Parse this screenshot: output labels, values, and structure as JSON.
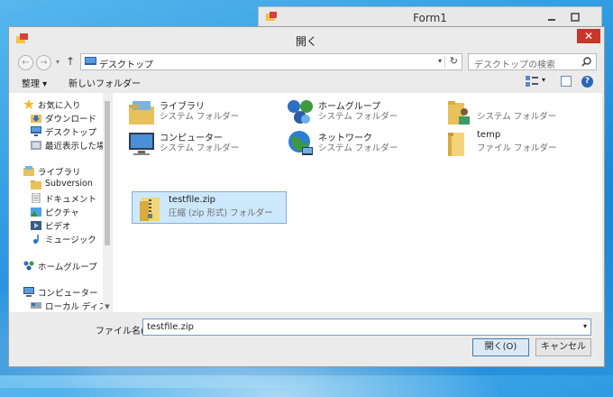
{
  "form1": {
    "title": "Form1"
  },
  "dialog": {
    "title": "開く",
    "close": "✕",
    "address": {
      "path": "デスクトップ",
      "dropdown": "▾",
      "refresh": "↻"
    },
    "nav": {
      "back": "←",
      "forward": "→",
      "history": "▾",
      "up": "↑"
    },
    "search": {
      "placeholder": "デスクトップの検索"
    },
    "toolbar": {
      "organize": "整理 ▾",
      "new_folder": "新しいフォルダー",
      "view_dropdown": "▾",
      "help": "?"
    },
    "sidebar": {
      "favorites": [
        {
          "label": "お気に入り",
          "icon": "star-icon"
        },
        {
          "label": "ダウンロード",
          "icon": "download-folder-icon"
        },
        {
          "label": "デスクトップ",
          "icon": "desktop-icon"
        },
        {
          "label": "最近表示した場所",
          "icon": "recent-places-icon"
        }
      ],
      "libraries": [
        {
          "label": "ライブラリ",
          "icon": "library-icon"
        },
        {
          "label": "Subversion",
          "icon": "folder-icon"
        },
        {
          "label": "ドキュメント",
          "icon": "documents-icon"
        },
        {
          "label": "ピクチャ",
          "icon": "pictures-icon"
        },
        {
          "label": "ビデオ",
          "icon": "videos-icon"
        },
        {
          "label": "ミュージック",
          "icon": "music-icon"
        }
      ],
      "homegroup": {
        "label": "ホームグループ",
        "icon": "homegroup-icon"
      },
      "computer": [
        {
          "label": "コンピューター",
          "icon": "computer-icon"
        },
        {
          "label": "ローカル ディスク (C",
          "icon": "drive-icon"
        }
      ]
    },
    "items": [
      {
        "name": "ライブラリ",
        "sub": "システム フォルダー",
        "icon": "library-icon"
      },
      {
        "name": "ホームグループ",
        "sub": "システム フォルダー",
        "icon": "homegroup-icon"
      },
      {
        "name": "",
        "sub": "システム フォルダー",
        "icon": "user-folder-icon"
      },
      {
        "name": "コンピューター",
        "sub": "システム フォルダー",
        "icon": "computer-icon"
      },
      {
        "name": "ネットワーク",
        "sub": "システム フォルダー",
        "icon": "network-icon"
      },
      {
        "name": "temp",
        "sub": "ファイル フォルダー",
        "icon": "folder-icon"
      },
      {
        "name": "testfile.zip",
        "sub": "圧縮 (zip 形式) フォルダー",
        "icon": "zip-folder-icon",
        "selected": true
      }
    ],
    "filename": {
      "label": "ファイル名(N):",
      "value": "testfile.zip",
      "dropdown": "▾"
    },
    "buttons": {
      "open": "開く(O)",
      "cancel": "キャンセル"
    }
  },
  "colors": {
    "accent": "#cde8fb",
    "close": "#c7362b",
    "desktop": "#2f9be2"
  }
}
